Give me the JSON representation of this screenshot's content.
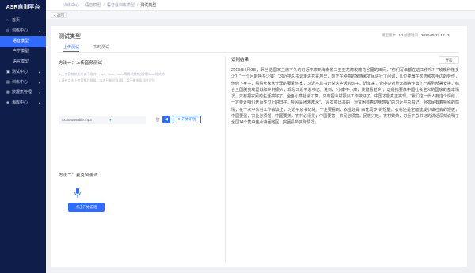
{
  "app": {
    "title": "ASR自训平台"
  },
  "sidebar": {
    "items": [
      {
        "label": "首页",
        "icon": "home-icon"
      },
      {
        "label": "训练中心",
        "icon": "training-icon",
        "expanded": true
      },
      {
        "label": "语音模型",
        "active": true
      },
      {
        "label": "声学模型"
      },
      {
        "label": "语言模型"
      },
      {
        "label": "测试中心",
        "icon": "test-icon"
      },
      {
        "label": "训练中心",
        "icon": "chart-icon"
      },
      {
        "label": "数据集管理",
        "icon": "dataset-icon"
      },
      {
        "label": "海库中心",
        "icon": "store-icon"
      }
    ]
  },
  "breadcrumb": [
    "训练中心",
    "语音模型",
    "语音自训练模型",
    "测试类型"
  ],
  "back_label": "< 返回",
  "panel": {
    "title": "测试类型",
    "meta": [
      {
        "label": "模型版本",
        "value": "V1"
      },
      {
        "label": "创建时间",
        "value": "2022-05-23 12:12"
      }
    ],
    "tabs": [
      "上传测试",
      "实时测试"
    ]
  },
  "left": {
    "method1_title": "方法一：上传音频测试",
    "hints": [
      "1.上传音频仅支持以下格式：mp3、wav、wma等格式音频文件和wav格式的",
      "2.请在点击上传音频后稍候，本次只能识别1段，暂不能多条同时识别"
    ],
    "file_name": "xxxxxwavable.mp3",
    "recognize_label": "开始识别",
    "method2_title": "方法二：麦克风测试",
    "start_label": "点击开始说话"
  },
  "right": {
    "title": "识别结果",
    "export_label": "导出",
    "text": "2013年4月9日，网当选国家主席不久的习近平来到海南省三亚亚龙湾玫瑰花谷里的田间，“你们写年都在这工作吗？”“玫瑰种植多少？”“一个月能挣多少钱？”习近平总书记走进花卉地里，向正在种盒的家族和农民进行了问询，几位瓷器在农药和农手边的劳作，他俯下身子，看看大家水土里的要素怀宽，习近平总书记说这些话的句子。近年来，党中央对重大战略作出了一系列部署安排，结合全国脱贫攻坚战和乡村振兴，现场习近平总书记，说到，“小康不小康，关键看老乡”，这是指要像中国社会主义的国家的基本情况，只有把农民的生活搞好了，全面小康社会才算，只有把乡村振兴工作做好了，中国才能真正实现。“我们这一代人有这个情结，一定要让咱们老百姓过上好日子，特别是困难群众”，“从农村出来的，对贫困有着切身感受”的习近平总书记，对农民有着特殊的感情，在一次中农村工作会议上，习近平总书记说，一定要看到，农业还是“四化同步”的短腿，农村还是全面建成小康社会的短板，中国要强，农业必须强；中国要美，农村必须美；中国要富，农民必须富。民族兴旺、农村繁荣，习近平总书记的讲话深刻说明了全国14个集中连片特困地区、贫困县的实际情况。"
  }
}
